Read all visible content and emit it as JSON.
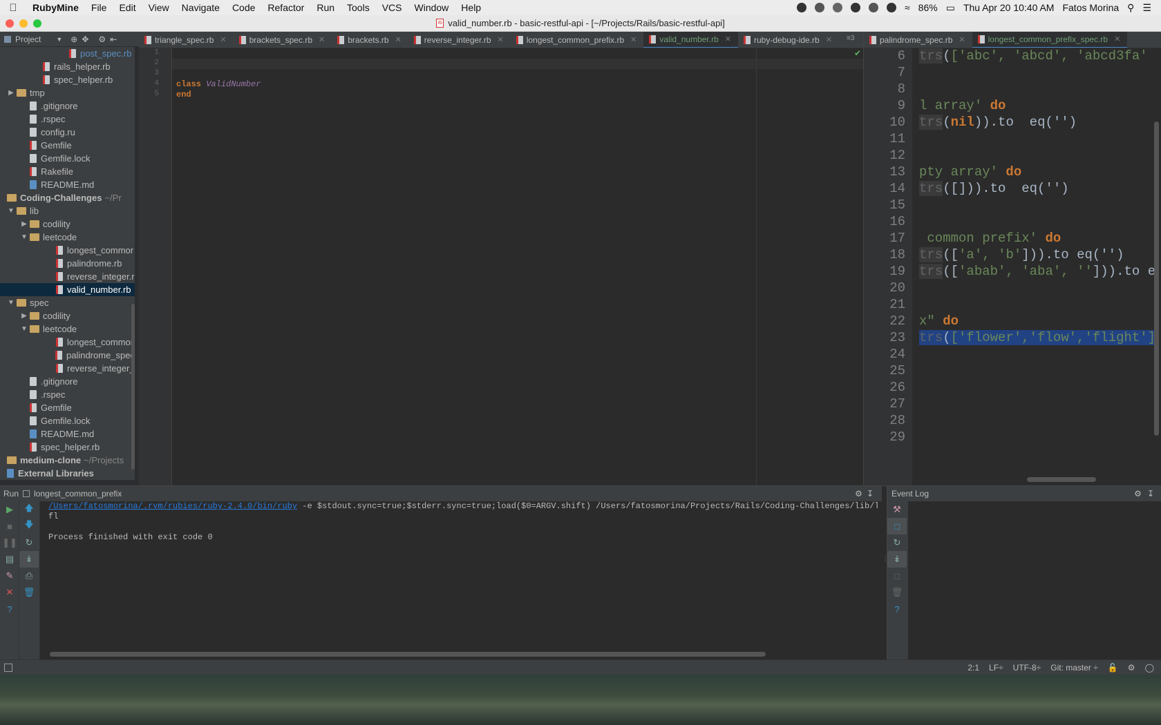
{
  "menubar": {
    "app": "RubyMine",
    "items": [
      "File",
      "Edit",
      "View",
      "Navigate",
      "Code",
      "Refactor",
      "Run",
      "Tools",
      "VCS",
      "Window",
      "Help"
    ],
    "battery": "86%",
    "clock": "Thu Apr 20  10:40 AM",
    "user": "Fatos Morina"
  },
  "window": {
    "title": "valid_number.rb - basic-restful-api - [~/Projects/Rails/basic-restful-api]"
  },
  "project_panel": {
    "label": "Project",
    "tree": [
      {
        "name": "post_spec.rb",
        "type": "rb",
        "depth": 4
      },
      {
        "name": "rails_helper.rb",
        "type": "rb",
        "depth": 2
      },
      {
        "name": "spec_helper.rb",
        "type": "rb",
        "depth": 2
      },
      {
        "name": "tmp",
        "type": "folder",
        "depth": 0,
        "arrow": "▶"
      },
      {
        "name": ".gitignore",
        "type": "file",
        "depth": 1
      },
      {
        "name": ".rspec",
        "type": "file",
        "depth": 1
      },
      {
        "name": "config.ru",
        "type": "file",
        "depth": 1
      },
      {
        "name": "Gemfile",
        "type": "rb",
        "depth": 1
      },
      {
        "name": "Gemfile.lock",
        "type": "file",
        "depth": 1
      },
      {
        "name": "Rakefile",
        "type": "rb",
        "depth": 1
      },
      {
        "name": "README.md",
        "type": "md",
        "depth": 1
      },
      {
        "name": "Coding-Challenges",
        "type": "folder",
        "depth": -1,
        "muted": "~/Pr"
      },
      {
        "name": "lib",
        "type": "folder",
        "depth": 0,
        "arrow": "▼"
      },
      {
        "name": "codility",
        "type": "folder",
        "depth": 1,
        "arrow": "▶"
      },
      {
        "name": "leetcode",
        "type": "folder",
        "depth": 1,
        "arrow": "▼"
      },
      {
        "name": "longest_commor",
        "type": "rb",
        "depth": 3
      },
      {
        "name": "palindrome.rb",
        "type": "rb",
        "depth": 3
      },
      {
        "name": "reverse_integer.r",
        "type": "rb",
        "depth": 3
      },
      {
        "name": "valid_number.rb",
        "type": "rb",
        "depth": 3,
        "selected": true
      },
      {
        "name": "spec",
        "type": "folder",
        "depth": 0,
        "arrow": "▼"
      },
      {
        "name": "codility",
        "type": "folder",
        "depth": 1,
        "arrow": "▶"
      },
      {
        "name": "leetcode",
        "type": "folder",
        "depth": 1,
        "arrow": "▼"
      },
      {
        "name": "longest_commor",
        "type": "rb",
        "depth": 3
      },
      {
        "name": "palindrome_spec",
        "type": "rb",
        "depth": 3
      },
      {
        "name": "reverse_integer_",
        "type": "rb",
        "depth": 3
      },
      {
        "name": ".gitignore",
        "type": "file",
        "depth": 1
      },
      {
        "name": ".rspec",
        "type": "file",
        "depth": 1
      },
      {
        "name": "Gemfile",
        "type": "rb",
        "depth": 1
      },
      {
        "name": "Gemfile.lock",
        "type": "file",
        "depth": 1
      },
      {
        "name": "README.md",
        "type": "md",
        "depth": 1
      },
      {
        "name": "spec_helper.rb",
        "type": "rb",
        "depth": 1
      },
      {
        "name": "medium-clone",
        "type": "folder",
        "depth": -1,
        "muted": "~/Projects"
      },
      {
        "name": "External Libraries",
        "type": "lib",
        "depth": -1
      }
    ]
  },
  "editor": {
    "tabs": [
      {
        "label": "triangle_spec.rb",
        "active": false
      },
      {
        "label": "brackets_spec.rb",
        "active": false
      },
      {
        "label": "brackets.rb",
        "active": false
      },
      {
        "label": "reverse_integer.rb",
        "active": false
      },
      {
        "label": "longest_common_prefix.rb",
        "active": false
      },
      {
        "label": "valid_number.rb",
        "active": true
      },
      {
        "label": "ruby-debug-ide.rb",
        "active": false
      }
    ],
    "tab_overflow": "3",
    "line_numbers": [
      "1",
      "2",
      "3",
      "4",
      "5"
    ],
    "code_keyword_class": "class",
    "code_class_name": "ValidNumber",
    "code_keyword_end": "end"
  },
  "split_editor": {
    "tabs": [
      {
        "label": "palindrome_spec.rb",
        "active": false
      },
      {
        "label": "longest_common_prefix_spec.rb",
        "active": true
      }
    ],
    "line_numbers": [
      "6",
      "7",
      "8",
      "9",
      "10",
      "11",
      "12",
      "13",
      "14",
      "15",
      "16",
      "17",
      "18",
      "19",
      "20",
      "21",
      "22",
      "23",
      "24",
      "25",
      "26",
      "27",
      "28",
      "29"
    ],
    "lines": [
      {
        "parts": [
          [
            "rg",
            "trs"
          ],
          [
            "",
            "("
          ],
          [
            "str",
            "['abc', 'abcd', 'abcd3fa'"
          ]
        ]
      },
      {
        "parts": []
      },
      {
        "parts": []
      },
      {
        "parts": [
          [
            "str",
            "l array' "
          ],
          [
            "kw",
            "do"
          ]
        ]
      },
      {
        "parts": [
          [
            "rg",
            "trs"
          ],
          [
            "",
            "("
          ],
          [
            "kw",
            "nil"
          ],
          [
            "",
            "))"
          ],
          [
            "",
            ".to  eq('')"
          ]
        ]
      },
      {
        "parts": []
      },
      {
        "parts": []
      },
      {
        "parts": [
          [
            "str",
            "pty array' "
          ],
          [
            "kw",
            "do"
          ]
        ]
      },
      {
        "parts": [
          [
            "rg",
            "trs"
          ],
          [
            "",
            "([])).to  eq('')"
          ]
        ]
      },
      {
        "parts": []
      },
      {
        "parts": []
      },
      {
        "parts": [
          [
            "str",
            " common prefix' "
          ],
          [
            "kw",
            "do"
          ]
        ]
      },
      {
        "parts": [
          [
            "rg",
            "trs"
          ],
          [
            "",
            "(["
          ],
          [
            "str",
            "'a', 'b'"
          ],
          [
            "",
            "])).to eq('')"
          ]
        ]
      },
      {
        "parts": [
          [
            "rg",
            "trs"
          ],
          [
            "",
            "(["
          ],
          [
            "str",
            "'abab', 'aba', ''"
          ],
          [
            "",
            "])).to e"
          ]
        ]
      },
      {
        "parts": []
      },
      {
        "parts": []
      },
      {
        "parts": [
          [
            "str",
            "x\" "
          ],
          [
            "kw",
            "do"
          ]
        ]
      },
      {
        "parts": [
          [
            "rg sel-hl",
            "trs"
          ],
          [
            "sel-hl",
            "("
          ],
          [
            "str sel-hl",
            "['flower','flow','flight']"
          ]
        ]
      },
      {
        "parts": []
      },
      {
        "parts": []
      },
      {
        "parts": []
      },
      {
        "parts": []
      },
      {
        "parts": []
      },
      {
        "parts": []
      }
    ]
  },
  "run_panel": {
    "label": "Run",
    "config": "longest_common_prefix",
    "console_link": "/Users/fatosmorina/.rvm/rubies/ruby-2.4.0/bin/ruby",
    "console_args": " -e $stdout.sync=true;$stderr.sync=true;load($0=ARGV.shift) /Users/fatosmorina/Projects/Rails/Coding-Challenges/lib/leetco",
    "output": "fl",
    "exit_message": "Process finished with exit code 0"
  },
  "event_log": {
    "label": "Event Log"
  },
  "status_bar": {
    "position": "2:1",
    "line_sep": "LF÷",
    "encoding": "UTF-8÷",
    "git": "Git: master ÷"
  }
}
